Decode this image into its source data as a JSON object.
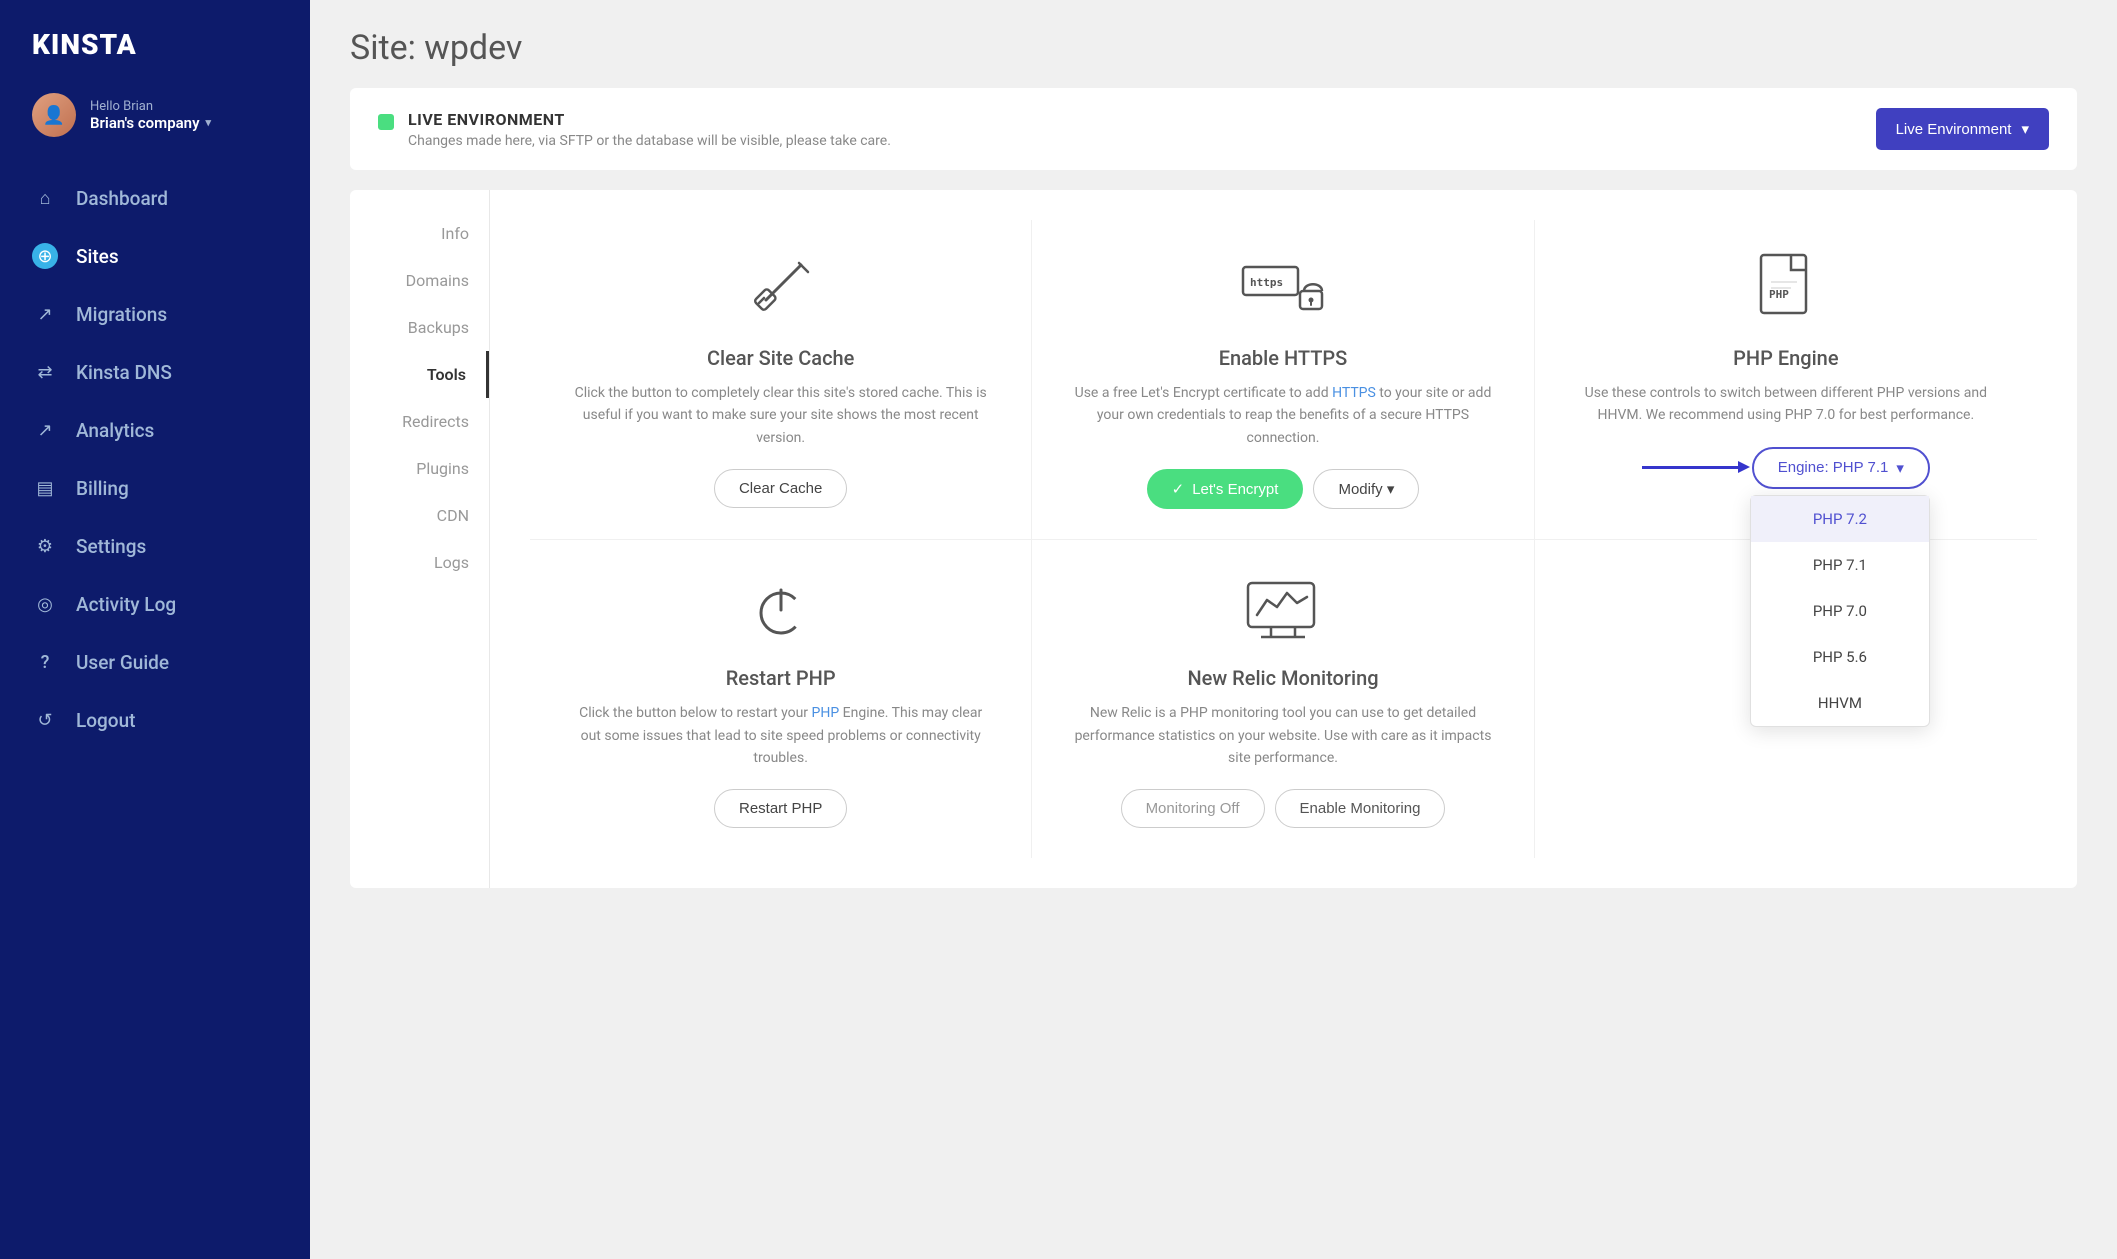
{
  "sidebar": {
    "logo": "KINSTA",
    "user": {
      "greeting": "Hello Brian",
      "company": "Brian's company"
    },
    "nav": [
      {
        "id": "dashboard",
        "label": "Dashboard",
        "icon": "home"
      },
      {
        "id": "sites",
        "label": "Sites",
        "icon": "sites",
        "active": true
      },
      {
        "id": "migrations",
        "label": "Migrations",
        "icon": "migrations"
      },
      {
        "id": "kinsta-dns",
        "label": "Kinsta DNS",
        "icon": "dns"
      },
      {
        "id": "analytics",
        "label": "Analytics",
        "icon": "analytics"
      },
      {
        "id": "billing",
        "label": "Billing",
        "icon": "billing"
      },
      {
        "id": "settings",
        "label": "Settings",
        "icon": "settings"
      },
      {
        "id": "activity-log",
        "label": "Activity Log",
        "icon": "activity"
      },
      {
        "id": "user-guide",
        "label": "User Guide",
        "icon": "guide"
      },
      {
        "id": "logout",
        "label": "Logout",
        "icon": "logout"
      }
    ]
  },
  "page": {
    "title": "Site: wpdev"
  },
  "environment": {
    "badge": "LIVE ENVIRONMENT",
    "description": "Changes made here, via SFTP or the database will be visible, please take care.",
    "dropdown_label": "Live Environment"
  },
  "sub_nav": {
    "items": [
      {
        "id": "info",
        "label": "Info"
      },
      {
        "id": "domains",
        "label": "Domains"
      },
      {
        "id": "backups",
        "label": "Backups"
      },
      {
        "id": "tools",
        "label": "Tools",
        "active": true
      },
      {
        "id": "redirects",
        "label": "Redirects"
      },
      {
        "id": "plugins",
        "label": "Plugins"
      },
      {
        "id": "cdn",
        "label": "CDN"
      },
      {
        "id": "logs",
        "label": "Logs"
      }
    ]
  },
  "tools": {
    "clear_cache": {
      "title": "Clear Site Cache",
      "description": "Click the button to completely clear this site's stored cache. This is useful if you want to make sure your site shows the most recent version.",
      "button_label": "Clear Cache"
    },
    "enable_https": {
      "title": "Enable HTTPS",
      "description": "Use a free Let's Encrypt certificate to add HTTPS to your site or add your own credentials to reap the benefits of a secure HTTPS connection.",
      "lets_encrypt_label": "Let's Encrypt",
      "modify_label": "Modify"
    },
    "php_engine": {
      "title": "PHP Engine",
      "description": "Use these controls to switch between different PHP versions and HHVM. We recommend using PHP 7.0 for best performance.",
      "current_version": "Engine: PHP 7.1",
      "options": [
        "PHP 7.2",
        "PHP 7.1",
        "PHP 7.0",
        "PHP 5.6",
        "HHVM"
      ],
      "selected": "PHP 7.2"
    },
    "restart_php": {
      "title": "Restart PHP",
      "description": "Click the button below to restart your PHP Engine. This may clear out some issues that lead to site speed problems or connectivity troubles.",
      "button_label": "Restart PHP",
      "php_link": "PHP"
    },
    "new_relic": {
      "title": "New Relic Monitoring",
      "description": "New Relic is a PHP monitoring tool you can use to get detailed performance statistics on your website. Use with care as it impacts site performance.",
      "monitoring_off_label": "Monitoring Off",
      "enable_label": "Enable Monitoring"
    }
  }
}
